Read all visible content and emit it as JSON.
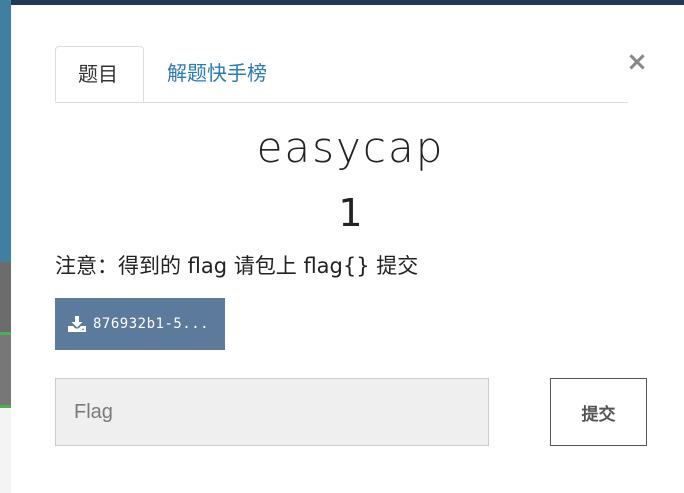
{
  "modal": {
    "tabs": [
      {
        "label": "题目",
        "active": true
      },
      {
        "label": "解题快手榜",
        "active": false
      }
    ],
    "close_label": "×",
    "challenge": {
      "title": "easycap",
      "points": "1",
      "note": "注意：得到的 flag 请包上 flag{} 提交"
    },
    "file": {
      "name": "876932b1-5...",
      "icon": "download-icon"
    },
    "flag_input": {
      "placeholder": "Flag",
      "value": ""
    },
    "submit_label": "提交"
  },
  "colors": {
    "tab_link": "#2a7ab8",
    "file_button": "#5b7a9c",
    "input_bg": "#efefef"
  }
}
